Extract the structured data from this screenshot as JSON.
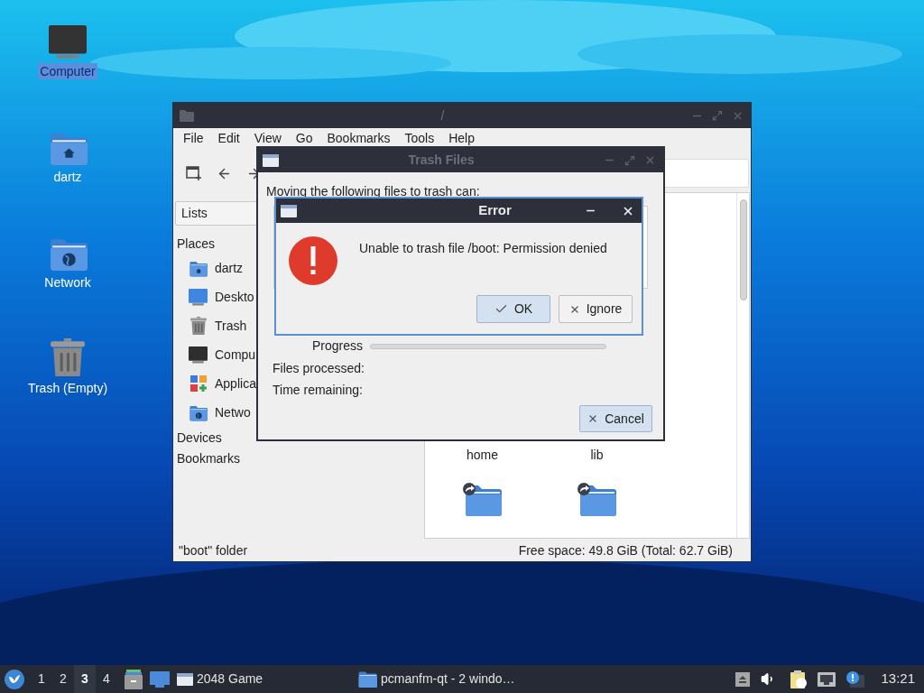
{
  "desktop": {
    "icons": [
      {
        "label": "Computer",
        "kind": "computer",
        "selected": true
      },
      {
        "label": "dartz",
        "kind": "home",
        "selected": false
      },
      {
        "label": "Network",
        "kind": "network",
        "selected": false
      },
      {
        "label": "Trash (Empty)",
        "kind": "trash",
        "selected": false
      }
    ]
  },
  "file_manager": {
    "title": "/",
    "menu": [
      "File",
      "Edit",
      "View",
      "Go",
      "Bookmarks",
      "Tools",
      "Help"
    ],
    "side_pane": {
      "view": "Lists",
      "sections": [
        {
          "title": "Places",
          "items": [
            {
              "label": "dartz",
              "kind": "home"
            },
            {
              "label": "Deskto",
              "kind": "desktop"
            },
            {
              "label": "Trash",
              "kind": "trash"
            },
            {
              "label": "Compu",
              "kind": "computer"
            },
            {
              "label": "Applica",
              "kind": "apps"
            },
            {
              "label": "Netwo",
              "kind": "network"
            }
          ]
        },
        {
          "title": "Devices"
        },
        {
          "title": "Bookmarks"
        }
      ]
    },
    "files": [
      {
        "name": "home"
      },
      {
        "name": "lib"
      }
    ],
    "status_left": "\"boot\" folder",
    "status_right": "Free space: 49.8 GiB (Total: 62.7 GiB)"
  },
  "trash_dialog": {
    "title": "Trash Files",
    "active": false,
    "message": "Moving the following files to trash can:",
    "progress_label": "Progress",
    "level": 0,
    "files_processed_label": "Files processed:",
    "time_remaining_label": "Time remaining:",
    "cancel": "Cancel"
  },
  "error_dialog": {
    "title": "Error",
    "message": "Unable to trash file /boot: Permission denied",
    "buttons": [
      {
        "label": "OK",
        "kind": "ok",
        "default": true
      },
      {
        "label": "Ignore",
        "kind": "ignore",
        "default": false
      }
    ]
  },
  "taskbar": {
    "workspaces": [
      {
        "label": "1",
        "selected": false
      },
      {
        "label": "2",
        "selected": false
      },
      {
        "label": "3",
        "selected": true
      },
      {
        "label": "4",
        "selected": false
      }
    ],
    "tasks": [
      {
        "label": "2048 Game",
        "kind": "window"
      },
      {
        "label": "pcmanfm-qt - 2 windo…",
        "kind": "folder"
      }
    ],
    "clock": "13:21"
  }
}
